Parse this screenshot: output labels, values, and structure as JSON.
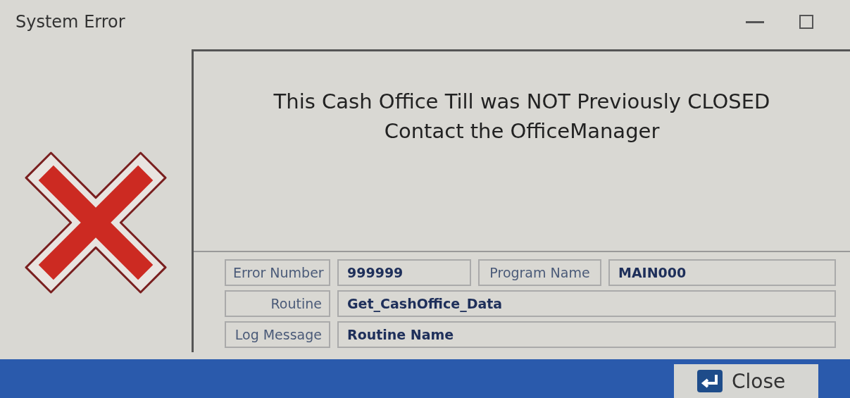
{
  "window": {
    "title": "System Error"
  },
  "message": {
    "lines": [
      "This Cash Office Till was NOT Previously CLOSED",
      "Contact the OfficeManager"
    ]
  },
  "fields": [
    [
      {
        "label": "Error Number",
        "value": "999999"
      },
      {
        "label": "Program Name",
        "value": "MAIN000"
      }
    ],
    [
      {
        "label": "Routine",
        "value": "Get_CashOffice_Data"
      }
    ],
    [
      {
        "label": "Log Message",
        "value": "Routine Name"
      }
    ]
  ],
  "buttons": [
    {
      "label": "Close"
    }
  ]
}
